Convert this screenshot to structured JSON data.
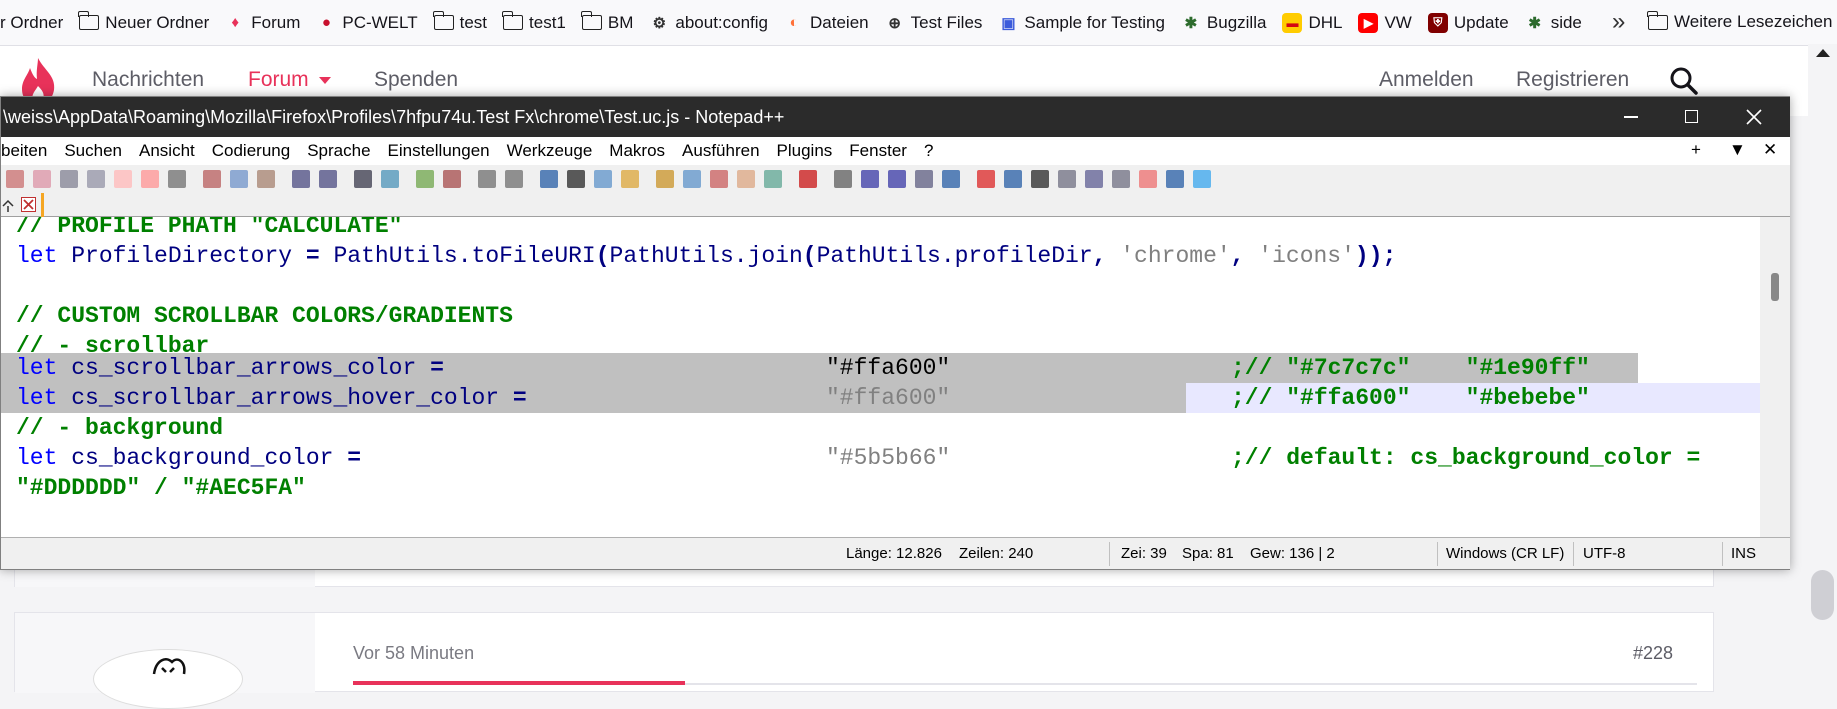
{
  "bookmarks": [
    {
      "label": "r Ordner",
      "icon": "folder-icon"
    },
    {
      "label": "Neuer Ordner",
      "icon": "folder-icon"
    },
    {
      "label": "Forum",
      "icon": "flame-icon"
    },
    {
      "label": "PC-WELT",
      "icon": "pcwelt-icon"
    },
    {
      "label": "test",
      "icon": "folder-icon"
    },
    {
      "label": "test1",
      "icon": "folder-icon"
    },
    {
      "label": "BM",
      "icon": "folder-icon"
    },
    {
      "label": "about:config",
      "icon": "gear-icon"
    },
    {
      "label": "Dateien",
      "icon": "firefox-icon"
    },
    {
      "label": "Test Files",
      "icon": "globe-icon"
    },
    {
      "label": "Sample for Testing",
      "icon": "sample-icon"
    },
    {
      "label": "Bugzilla",
      "icon": "bugzilla-icon"
    },
    {
      "label": "DHL",
      "icon": "dhl-icon"
    },
    {
      "label": "VW",
      "icon": "youtube-icon"
    },
    {
      "label": "Update",
      "icon": "ublock-icon"
    },
    {
      "label": "side",
      "icon": "bugzilla-icon"
    }
  ],
  "bookmarks_more": "»",
  "bookmarks_other": "Weitere Lesezeichen",
  "forum": {
    "nav": [
      "Nachrichten",
      "Forum",
      "Spenden"
    ],
    "login": "Anmelden",
    "register": "Registrieren",
    "post_time": "Vor 58 Minuten",
    "post_number": "#228",
    "colors": {
      "accent": "#e8325a",
      "nav_text": "#5d5d66"
    }
  },
  "npp": {
    "title": "\\weiss\\AppData\\Roaming\\Mozilla\\Firefox\\Profiles\\7hfpu74u.Test Fx\\chrome\\Test.uc.js - Notepad++",
    "menu": [
      "beiten",
      "Suchen",
      "Ansicht",
      "Codierung",
      "Sprache",
      "Einstellungen",
      "Werkzeuge",
      "Makros",
      "Ausführen",
      "Plugins",
      "Fenster",
      "?"
    ],
    "menu_right": [
      "+",
      "▼",
      "✕"
    ],
    "code": {
      "c1": "// PROFILE PHATH \"CALCULATE\"",
      "l2_kw": "let",
      "l2_id": " ProfileDirectory ",
      "l2_eq": "=",
      "l2_a": " PathUtils.toFileURI",
      "l2_p1": "(",
      "l2_b": "PathUtils.join",
      "l2_p2": "(",
      "l2_c": "PathUtils.profileDir",
      "l2_cm1": ", ",
      "l2_s1": "'chrome'",
      "l2_cm2": ", ",
      "l2_s2": "'icons'",
      "l2_end": "));",
      "c4": "// CUSTOM SCROLLBAR COLORS/GRADIENTS",
      "c5": "// - scrollbar",
      "l6_id": " cs_scrollbar_arrows_color ",
      "l6_val": "\"#ffa600\"",
      "l6_cm": ";// \"#7c7c7c\"    \"#1e90ff\"",
      "l7_id": " cs_scrollbar_arrows_hover_color ",
      "l7_val": "\"#ffa600\"",
      "l7_cm": ";// \"#ffa600\"    \"#bebebe\"",
      "c8": "// - background",
      "l9_id": " cs_background_color ",
      "l9_val": "\"#5b5b66\"",
      "l9_cm": ";// default: cs_background_color =",
      "c10": "\"#DDDDDD\" / \"#AEC5FA\""
    },
    "status": {
      "length": "Länge: 12.826",
      "lines": "Zeilen: 240",
      "ln": "Zei: 39",
      "col": "Spa: 81",
      "sel": "Gew: 136 | 2",
      "eol": "Windows (CR LF)",
      "enc": "UTF-8",
      "mode": "INS"
    },
    "colors": {
      "comment": "#008000",
      "keyword": "#0000ff",
      "identifier": "#000080",
      "string": "#808080",
      "selection": "#c0c0c0"
    }
  }
}
